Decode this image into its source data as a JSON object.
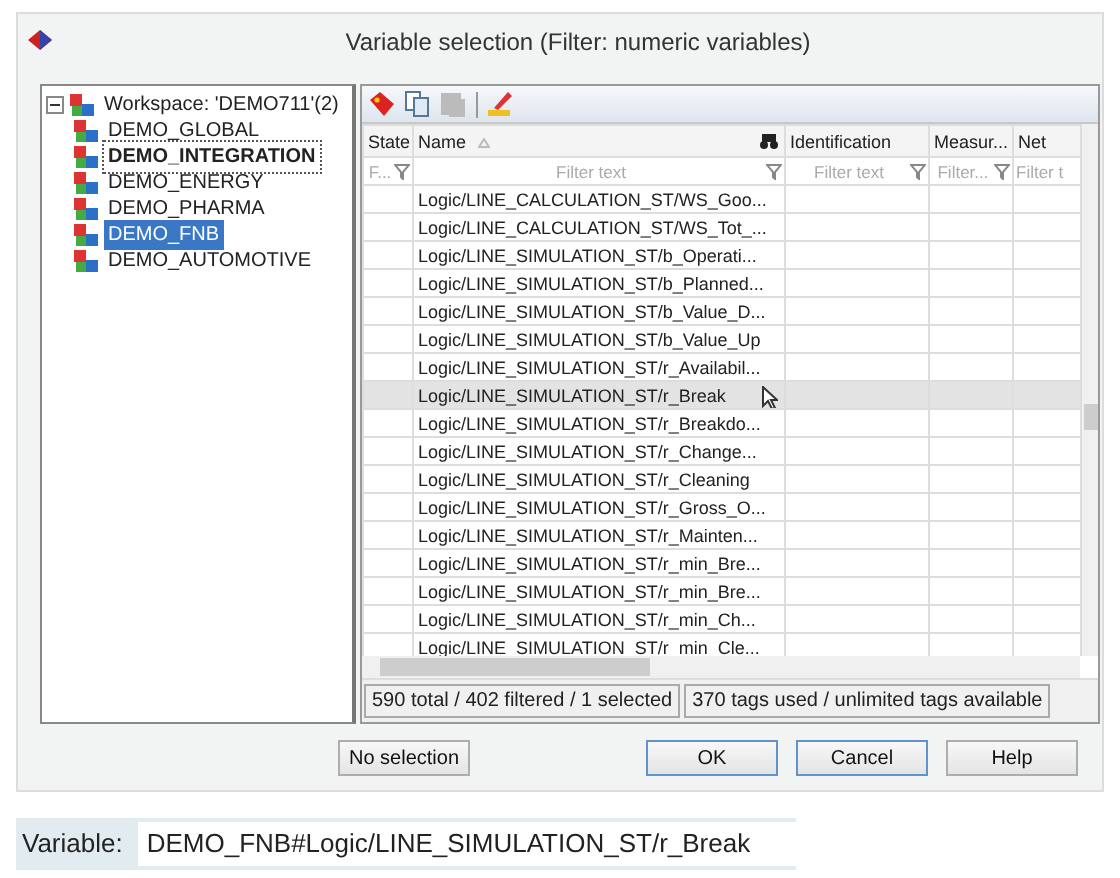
{
  "window": {
    "title": "Variable selection (Filter: numeric variables)"
  },
  "tree": {
    "label": "Workspace: 'DEMO711'(2)",
    "expanded": true,
    "children": [
      {
        "label": "DEMO_GLOBAL",
        "selected": false,
        "bold": false
      },
      {
        "label": "DEMO_INTEGRATION",
        "selected": false,
        "bold": true
      },
      {
        "label": "DEMO_ENERGY",
        "selected": false,
        "bold": false
      },
      {
        "label": "DEMO_PHARMA",
        "selected": false,
        "bold": false
      },
      {
        "label": "DEMO_FNB",
        "selected": true,
        "bold": false
      },
      {
        "label": "DEMO_AUTOMOTIVE",
        "selected": false,
        "bold": false
      }
    ]
  },
  "toolbar": [
    {
      "kind": "tag",
      "disabled": false
    },
    {
      "kind": "copy",
      "disabled": false
    },
    {
      "kind": "paste",
      "disabled": true
    },
    {
      "kind": "separator"
    },
    {
      "kind": "edit",
      "disabled": false
    }
  ],
  "table": {
    "columns": [
      {
        "label": "State",
        "filter_placeholder": "F..."
      },
      {
        "label": "Name",
        "filter_placeholder": "Filter text",
        "sorted": true
      },
      {
        "label": "Identification",
        "filter_placeholder": "Filter text"
      },
      {
        "label": "Measur...",
        "filter_placeholder": "Filter..."
      },
      {
        "label": "Net",
        "filter_placeholder": "Filter t"
      }
    ],
    "rows": [
      {
        "name": "Logic/LINE_CALCULATION_ST/WS_Goo...",
        "selected": false
      },
      {
        "name": "Logic/LINE_CALCULATION_ST/WS_Tot_...",
        "selected": false
      },
      {
        "name": "Logic/LINE_SIMULATION_ST/b_Operati...",
        "selected": false
      },
      {
        "name": "Logic/LINE_SIMULATION_ST/b_Planned...",
        "selected": false
      },
      {
        "name": "Logic/LINE_SIMULATION_ST/b_Value_D...",
        "selected": false
      },
      {
        "name": "Logic/LINE_SIMULATION_ST/b_Value_Up",
        "selected": false
      },
      {
        "name": "Logic/LINE_SIMULATION_ST/r_Availabil...",
        "selected": false
      },
      {
        "name": "Logic/LINE_SIMULATION_ST/r_Break",
        "selected": true
      },
      {
        "name": "Logic/LINE_SIMULATION_ST/r_Breakdo...",
        "selected": false
      },
      {
        "name": "Logic/LINE_SIMULATION_ST/r_Change...",
        "selected": false
      },
      {
        "name": "Logic/LINE_SIMULATION_ST/r_Cleaning",
        "selected": false
      },
      {
        "name": "Logic/LINE_SIMULATION_ST/r_Gross_O...",
        "selected": false
      },
      {
        "name": "Logic/LINE_SIMULATION_ST/r_Mainten...",
        "selected": false
      },
      {
        "name": "Logic/LINE_SIMULATION_ST/r_min_Bre...",
        "selected": false
      },
      {
        "name": "Logic/LINE_SIMULATION_ST/r_min_Bre...",
        "selected": false
      },
      {
        "name": "Logic/LINE_SIMULATION_ST/r_min_Ch...",
        "selected": false
      },
      {
        "name": "Logic/LINE_SIMULATION_ST/r_min_Cle...",
        "selected": false
      }
    ]
  },
  "status_bar": [
    "590 total / 402 filtered / 1 selected",
    "370 tags used / unlimited tags available"
  ],
  "buttons": [
    {
      "label": "No selection",
      "kind": "left"
    },
    {
      "label": "OK",
      "kind": "default"
    },
    {
      "label": "Cancel",
      "kind": "default"
    },
    {
      "label": "Help",
      "kind": "plain"
    }
  ],
  "variable": {
    "label": "Variable:",
    "value": "DEMO_FNB#Logic/LINE_SIMULATION_ST/r_Break"
  }
}
